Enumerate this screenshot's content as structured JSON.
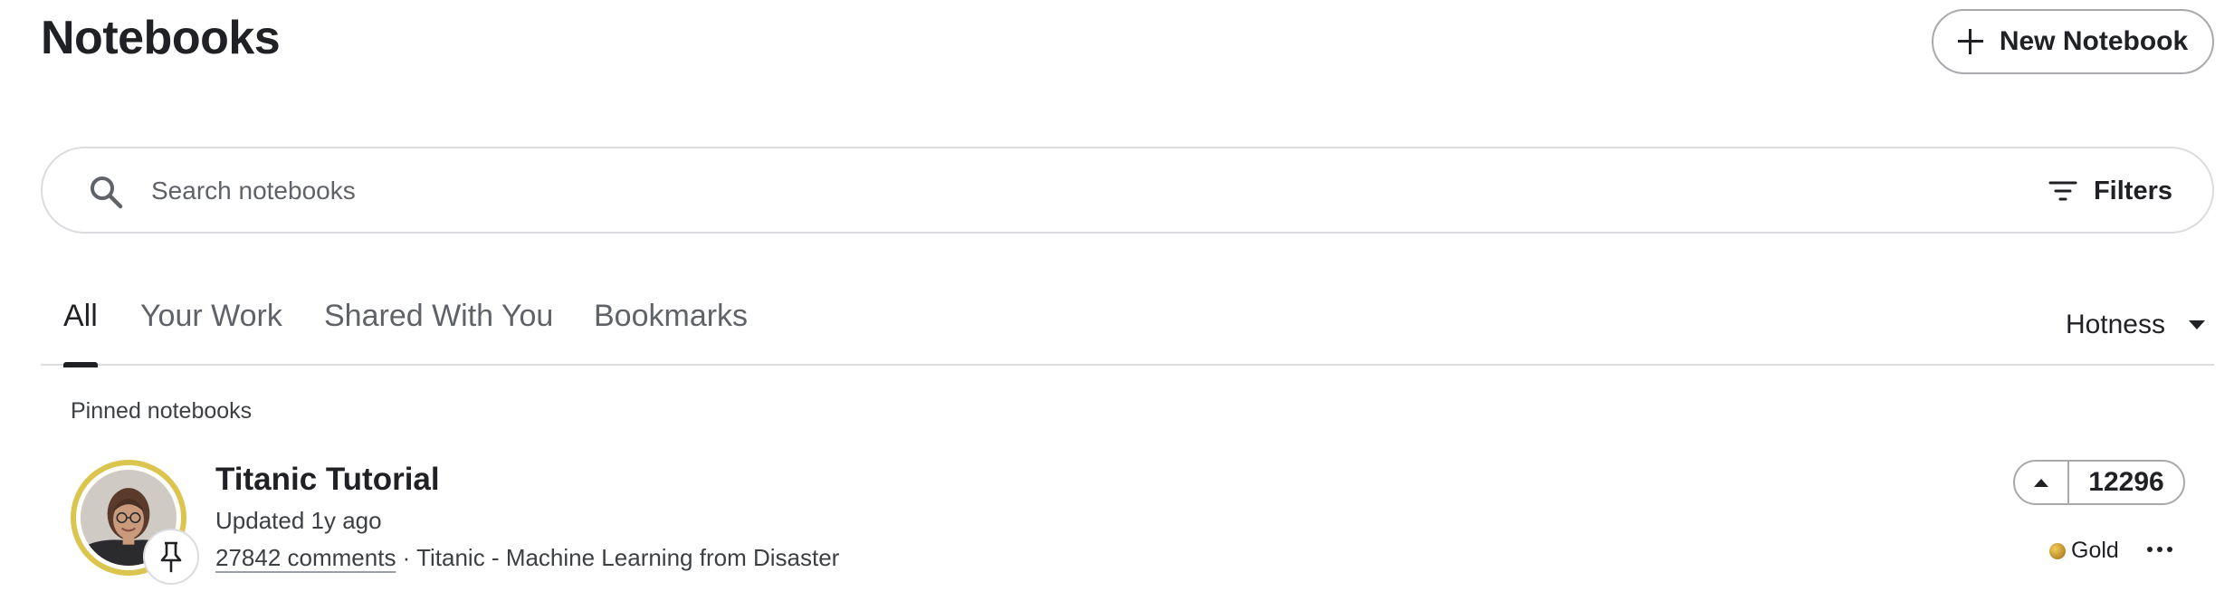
{
  "header": {
    "title": "Notebooks",
    "new_button_label": "New Notebook",
    "new_button_icon": "plus-icon"
  },
  "search": {
    "placeholder": "Search notebooks",
    "value": "",
    "icon": "search-icon",
    "filters_label": "Filters",
    "filters_icon": "filter-icon"
  },
  "tabs": {
    "items": [
      {
        "label": "All",
        "active": true
      },
      {
        "label": "Your Work",
        "active": false
      },
      {
        "label": "Shared With You",
        "active": false
      },
      {
        "label": "Bookmarks",
        "active": false
      }
    ],
    "sort": {
      "selected": "Hotness",
      "icon": "caret-down-icon"
    }
  },
  "pinned": {
    "section_label": "Pinned notebooks",
    "notebook": {
      "title": "Titanic Tutorial",
      "updated": "Updated 1y ago",
      "comments": "27842 comments",
      "separator": " · ",
      "competition": "Titanic - Machine Learning from Disaster",
      "votes": "12296",
      "medal": "Gold",
      "medal_color": "#d4a537",
      "avatar_ring_color": "#dbc54f",
      "pin_icon": "pin-icon",
      "upvote_icon": "upvote-caret-icon",
      "more_icon": "more-horizontal-icon"
    }
  },
  "colors": {
    "text_primary": "#202124",
    "text_secondary": "#5f6368",
    "border": "#dadce0"
  }
}
